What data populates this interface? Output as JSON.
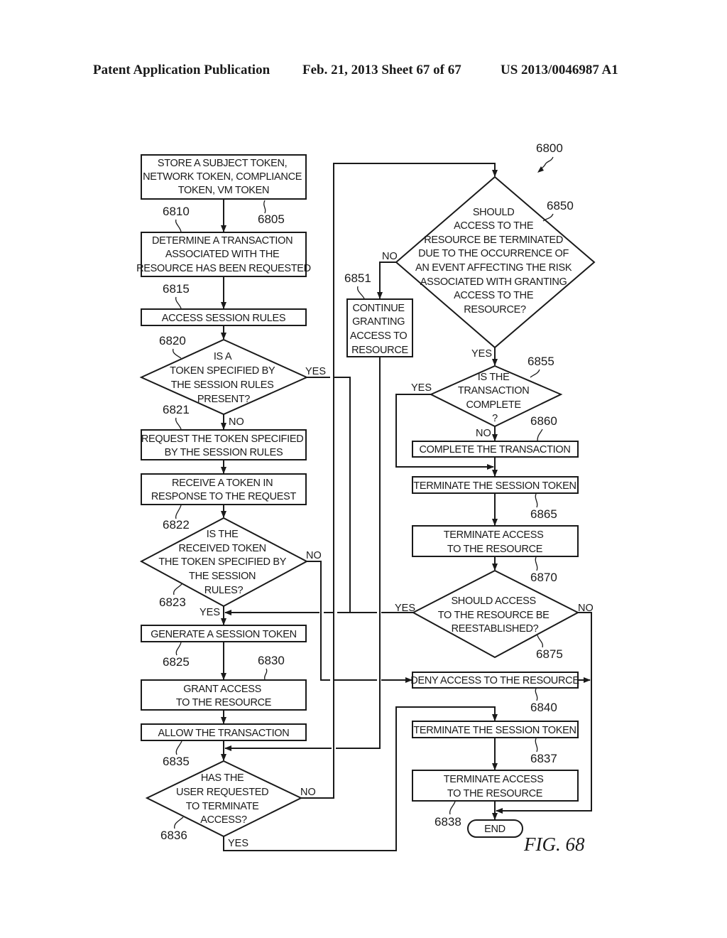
{
  "header": {
    "publication": "Patent Application Publication",
    "date_sheet": "Feb. 21, 2013   Sheet 67 of 67",
    "patent_number": "US 2013/0046987 A1"
  },
  "figure": {
    "label": "FIG. 68",
    "ref": "6800"
  },
  "nodes": {
    "n6805": {
      "ref": "6805",
      "lines": [
        "STORE A SUBJECT TOKEN,",
        "NETWORK TOKEN, COMPLIANCE",
        "TOKEN, VM TOKEN"
      ]
    },
    "n6810": {
      "ref": "6810",
      "lines": [
        "DETERMINE A TRANSACTION",
        "ASSOCIATED WITH THE",
        "RESOURCE HAS BEEN REQUESTED"
      ]
    },
    "n6815": {
      "ref": "6815",
      "lines": [
        "ACCESS SESSION RULES"
      ]
    },
    "n6820": {
      "ref": "6820",
      "lines": [
        "IS A",
        "TOKEN SPECIFIED BY",
        "THE SESSION RULES",
        "PRESENT?"
      ]
    },
    "n6821": {
      "ref": "6821",
      "lines": [
        "REQUEST THE TOKEN SPECIFIED",
        "BY THE SESSION RULES"
      ]
    },
    "n6822": {
      "ref": "6822",
      "lines": [
        "RECEIVE A TOKEN IN",
        "RESPONSE TO THE REQUEST"
      ]
    },
    "n6823": {
      "ref": "6823",
      "lines": [
        "IS THE",
        "RECEIVED TOKEN",
        "THE TOKEN SPECIFIED BY",
        "THE SESSION",
        "RULES?"
      ]
    },
    "n6825": {
      "ref": "6825",
      "lines": [
        "GENERATE A SESSION TOKEN"
      ]
    },
    "n6830": {
      "ref": "6830",
      "lines": [
        "GRANT ACCESS",
        "TO THE RESOURCE"
      ]
    },
    "n6835": {
      "ref": "6835",
      "lines": [
        "ALLOW THE TRANSACTION"
      ]
    },
    "n6836": {
      "ref": "6836",
      "lines": [
        "HAS THE",
        "USER REQUESTED",
        "TO TERMINATE",
        "ACCESS?"
      ]
    },
    "n6850": {
      "ref": "6850",
      "lines": [
        "SHOULD",
        "ACCESS TO THE",
        "RESOURCE BE TERMINATED",
        "DUE TO THE OCCURRENCE OF",
        "AN EVENT AFFECTING THE RISK",
        "ASSOCIATED WITH GRANTING",
        "ACCESS TO THE",
        "RESOURCE?"
      ]
    },
    "n6851": {
      "ref": "6851",
      "lines": [
        "CONTINUE",
        "GRANTING",
        "ACCESS TO",
        "RESOURCE"
      ]
    },
    "n6855": {
      "ref": "6855",
      "lines": [
        "IS THE",
        "TRANSACTION",
        "COMPLETE",
        "?"
      ]
    },
    "n6860": {
      "ref": "6860",
      "lines": [
        "COMPLETE THE TRANSACTION"
      ]
    },
    "n6865": {
      "ref": "6865",
      "lines": [
        "TERMINATE THE SESSION TOKEN"
      ]
    },
    "n6870": {
      "ref": "6870",
      "lines": [
        "TERMINATE ACCESS",
        "TO THE RESOURCE"
      ]
    },
    "n6875": {
      "ref": "6875",
      "lines": [
        "SHOULD ACCESS",
        "TO THE RESOURCE BE",
        "REESTABLISHED?"
      ]
    },
    "n6840": {
      "ref": "6840",
      "lines": [
        "DENY ACCESS TO THE RESOURCE"
      ]
    },
    "n6837": {
      "ref": "6837",
      "lines": [
        "TERMINATE THE SESSION TOKEN"
      ]
    },
    "n6838": {
      "ref": "6838",
      "lines": [
        "TERMINATE ACCESS",
        "TO THE RESOURCE"
      ]
    },
    "end": {
      "lines": [
        "END"
      ]
    }
  },
  "branch_labels": {
    "yes": "YES",
    "no": "NO"
  }
}
